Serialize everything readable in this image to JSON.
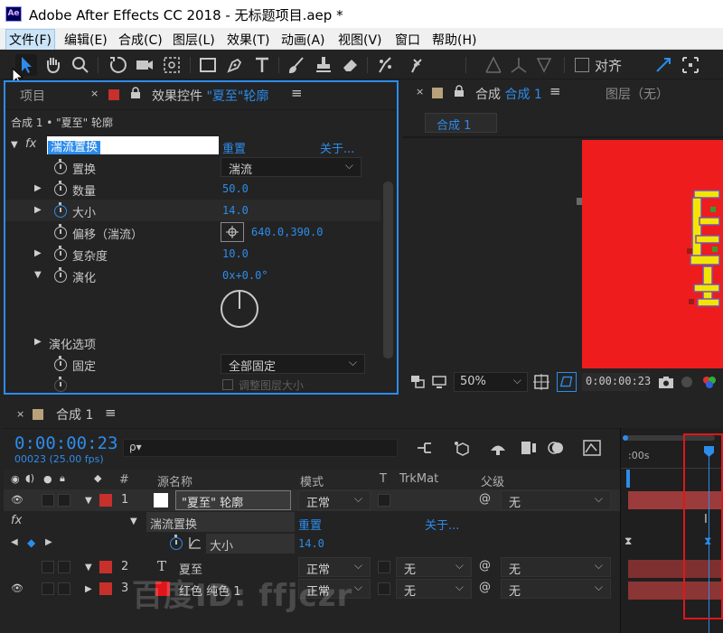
{
  "window": {
    "app_icon": "Ae",
    "title": "Adobe After Effects CC 2018 - 无标题项目.aep *"
  },
  "menu": [
    "文件(F)",
    "编辑(E)",
    "合成(C)",
    "图层(L)",
    "效果(T)",
    "动画(A)",
    "视图(V)",
    "窗口",
    "帮助(H)"
  ],
  "toolbar": {
    "tools": [
      "selection-tool",
      "hand-tool",
      "zoom-tool",
      "rotate-tool",
      "camera-tool",
      "pan-behind-tool",
      "rectangle-tool",
      "pen-tool",
      "type-tool",
      "brush-tool",
      "clone-stamp-tool",
      "eraser-tool",
      "roto-brush-tool",
      "puppet-tool"
    ],
    "align_label": "对齐"
  },
  "effects_panel": {
    "tab_project": "项目",
    "tab_effects_prefix": "效果控件 ",
    "tab_effects_layer": "\"夏至\"轮廓",
    "breadcrumb": "合成 1 • \"夏至\" 轮廓",
    "fx_label": "fx",
    "effect_name": "湍流置换",
    "reset": "重置",
    "about": "关于...",
    "params": [
      {
        "name": "置换",
        "value": "湍流"
      },
      {
        "name": "数量",
        "value": "50.0"
      },
      {
        "name": "大小",
        "value": "14.0"
      },
      {
        "name": "偏移（湍流）",
        "value": "640.0,390.0"
      },
      {
        "name": "复杂度",
        "value": "10.0"
      },
      {
        "name": "演化",
        "value": "0x+0.0°"
      },
      {
        "name": "演化选项",
        "value": ""
      },
      {
        "name": "固定",
        "value": "全部固定"
      },
      {
        "name": "调整图层大小",
        "value": ""
      }
    ]
  },
  "viewer": {
    "tab_comp_prefix": "合成 ",
    "tab_comp_name": "合成 1",
    "tab_layer": "图层（无）",
    "comp_button": "合成 1",
    "zoom": "50%",
    "timecode": "0:00:00:23",
    "comp_bg_color": "#ee1c1c"
  },
  "timeline": {
    "tab": "合成 1",
    "timecode": "0:00:00:23",
    "frame_info": "00023 (25.00 fps)",
    "search_placeholder": "ρ▾",
    "columns": {
      "num": "#",
      "source": "源名称",
      "mode": "模式",
      "t": "T",
      "trkmat": "TrkMat",
      "parent": "父级"
    },
    "ruler_label": ":00s",
    "layers": [
      {
        "num": "1",
        "type": "text",
        "name": "\"夏至\" 轮廓",
        "mode": "正常",
        "trkmat": "",
        "parent": "无",
        "label_color": "#c8302c"
      },
      {
        "num": "2",
        "type": "text",
        "name": "夏至",
        "mode": "正常",
        "trkmat": "无",
        "parent": "无",
        "label_color": "#c8302c"
      },
      {
        "num": "3",
        "type": "solid",
        "name": "红色 纯色 1",
        "mode": "正常",
        "trkmat": "无",
        "parent": "无",
        "label_color": "#c8302c"
      }
    ],
    "effect_row": {
      "fx": "fx",
      "name": "湍流置换",
      "reset": "重置",
      "about": "关于..."
    },
    "property_row": {
      "name": "大小",
      "value": "14.0"
    }
  },
  "watermark": "百度ID: ffjczr",
  "colors": {
    "accent": "#2d8ceb",
    "highlight_red": "#e0161a",
    "label_red": "#c8302c"
  }
}
